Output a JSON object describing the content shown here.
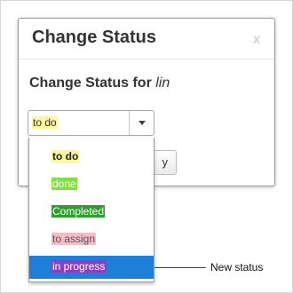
{
  "dialog": {
    "title": "Change Status",
    "close_symbol": "x",
    "body_title_prefix": "Change Status for",
    "user_name": "lin"
  },
  "status_select": {
    "selected_value": "to do",
    "arrow_icon": "caret-down-icon"
  },
  "partially_hidden_button": {
    "visible_text": "y"
  },
  "status_options": [
    {
      "label": "to do",
      "color": "#fff59d"
    },
    {
      "label": "done",
      "color": "#80e040"
    },
    {
      "label": "Completed",
      "color": "#2e9e2e"
    },
    {
      "label": "to assign",
      "color": "#f7bcc8"
    },
    {
      "label": "in progress",
      "color": "#8a3fc0",
      "highlighted": true,
      "highlight_color": "#1e7fd9"
    }
  ],
  "annotation": {
    "text": "New status",
    "line_color": "#cc0000"
  }
}
